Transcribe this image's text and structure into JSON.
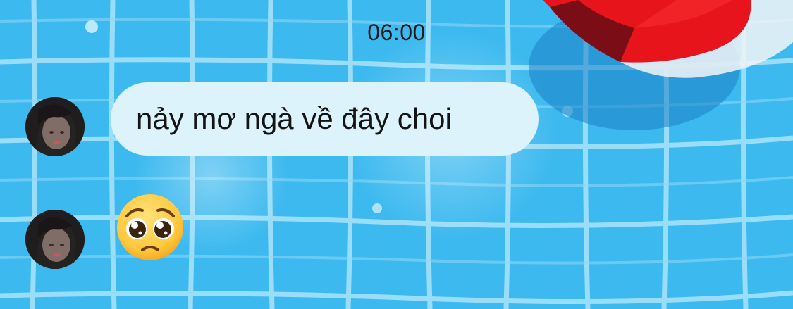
{
  "chat": {
    "timestamp": "06:00",
    "messages": [
      {
        "type": "text",
        "text": "nảy mơ ngà về đây choi",
        "sender_avatar": "user-avatar"
      },
      {
        "type": "emoji",
        "emoji_name": "pleading-face-emoji",
        "sender_avatar": "user-avatar"
      }
    ]
  },
  "colors": {
    "pool_blue": "#46c3f3",
    "tile_grout": "#9fe0fb",
    "bubble": "#dcf3fc",
    "ball_red": "#e8141c",
    "ball_dark_red": "#7a0d16",
    "emoji_yellow": "#ffc83d"
  }
}
